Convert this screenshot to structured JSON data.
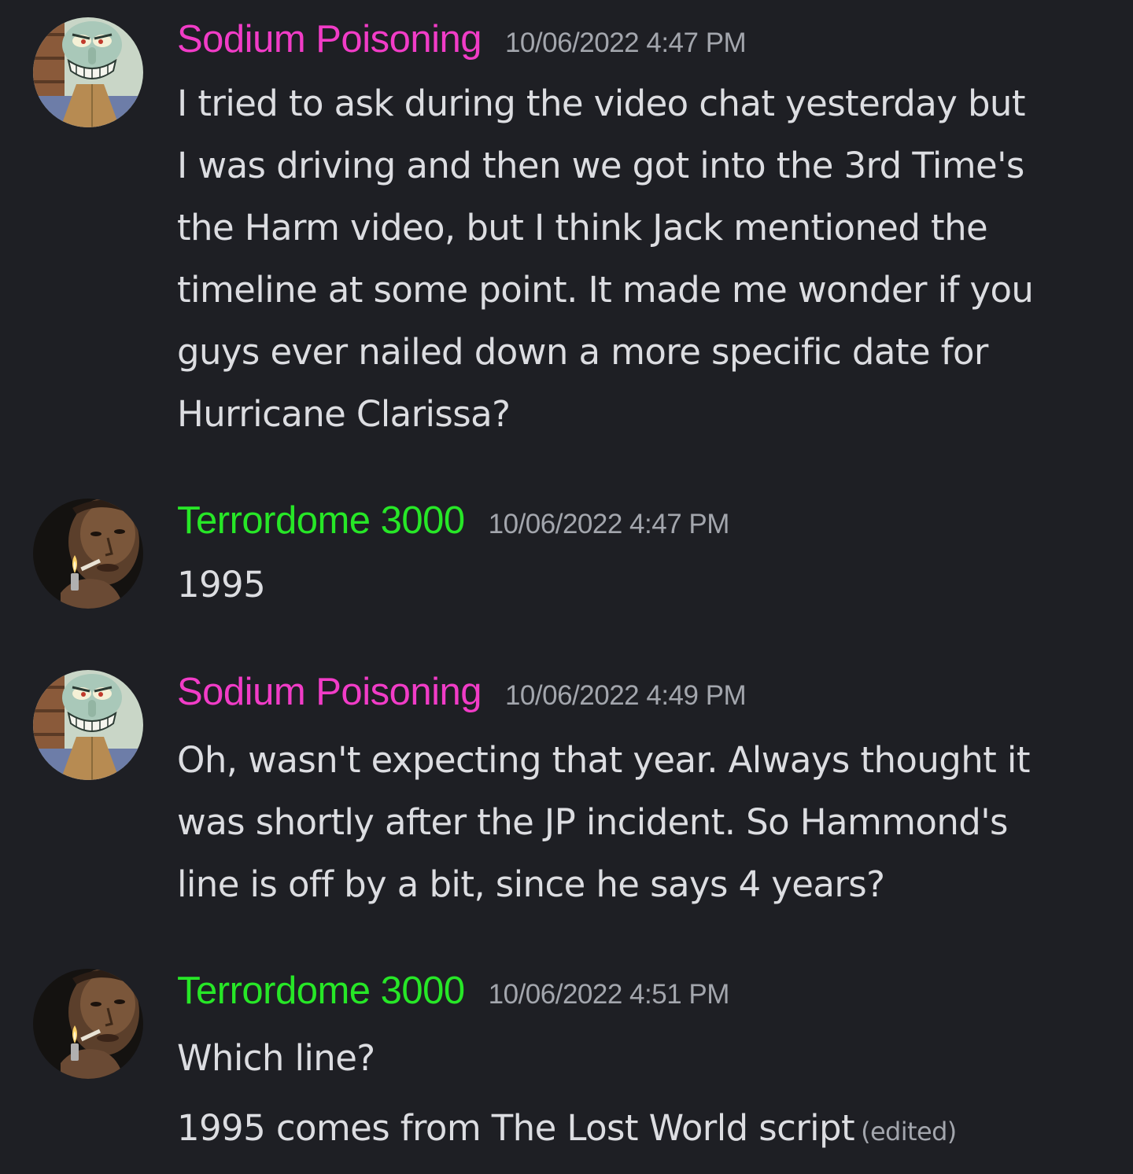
{
  "messages": [
    {
      "author": "Sodium Poisoning",
      "timestamp": "10/06/2022 4:47 PM",
      "author_color": "#f13cc7",
      "avatar_icon": "squidward-avatar",
      "lines": [
        "I tried to ask during the video chat yesterday but",
        "I was driving and then we got into the 3rd Time's",
        "the Harm video, but I think Jack mentioned the",
        "timeline at some point. It made me wonder if you",
        "guys ever nailed down a more specific date for",
        "Hurricane Clarissa?"
      ]
    },
    {
      "author": "Terrordome 3000",
      "timestamp": "10/06/2022 4:47 PM",
      "author_color": "#27e727",
      "avatar_icon": "smoking-man-avatar",
      "lines": [
        "1995"
      ]
    },
    {
      "author": "Sodium Poisoning",
      "timestamp": "10/06/2022 4:49 PM",
      "author_color": "#f13cc7",
      "avatar_icon": "squidward-avatar",
      "lines": [
        "Oh, wasn't expecting that year. Always thought it",
        "was shortly after the JP incident. So Hammond's",
        "line is off by a bit, since he says 4 years?"
      ]
    },
    {
      "author": "Terrordome 3000",
      "timestamp": "10/06/2022 4:51 PM",
      "author_color": "#27e727",
      "avatar_icon": "smoking-man-avatar",
      "lines": [
        "Which line?",
        "1995 comes from The Lost World script"
      ],
      "edited_label": "(edited)"
    }
  ]
}
